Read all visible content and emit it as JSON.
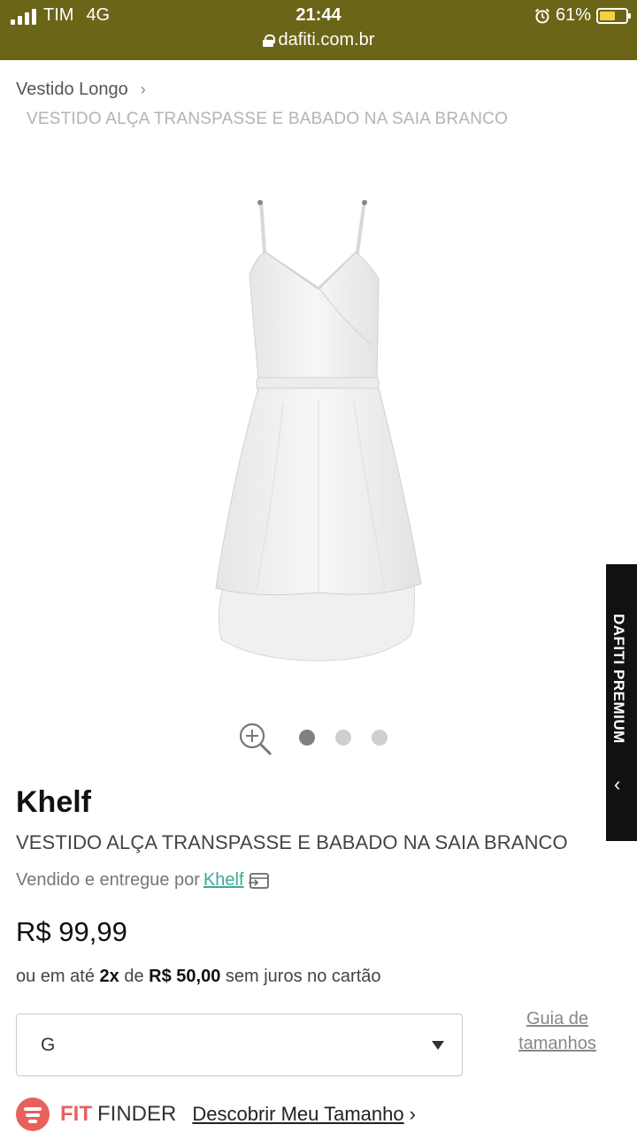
{
  "status_bar": {
    "carrier": "TIM",
    "network": "4G",
    "time": "21:44",
    "battery": "61%",
    "battery_level": 0.61,
    "url": "dafiti.com.br"
  },
  "breadcrumb": {
    "category": "Vestido Longo",
    "chevron": "›",
    "current": "VESTIDO ALÇA TRANSPASSE E BABADO NA SAIA BRANCO"
  },
  "gallery": {
    "image_count": 3,
    "active_index": 0
  },
  "side_tab": {
    "label": "DAFITI PREMIUM",
    "chevron": "‹"
  },
  "product": {
    "brand": "Khelf",
    "name": "VESTIDO ALÇA TRANSPASSE E BABADO NA SAIA BRANCO",
    "seller_prefix": "Vendido e entregue por",
    "seller_name": "Khelf",
    "price": "R$ 99,99",
    "installments": {
      "prefix": "ou em até",
      "count": "2x",
      "middle": "de",
      "amount": "R$ 50,00",
      "suffix": "sem juros no cartão"
    }
  },
  "size": {
    "selected": "G",
    "guide_line1": "Guia de",
    "guide_line2": "tamanhos"
  },
  "fit_finder": {
    "brand_bold": "FIT",
    "brand_light": "FINDER",
    "link": "Descobrir Meu Tamanho",
    "chevron": "›"
  },
  "colors": {
    "header_bg": "#6b6518",
    "link_teal": "#3aab95",
    "fit_red": "#e8615c",
    "dot_active": "#808080",
    "dot_inactive": "#cfcfcf"
  }
}
